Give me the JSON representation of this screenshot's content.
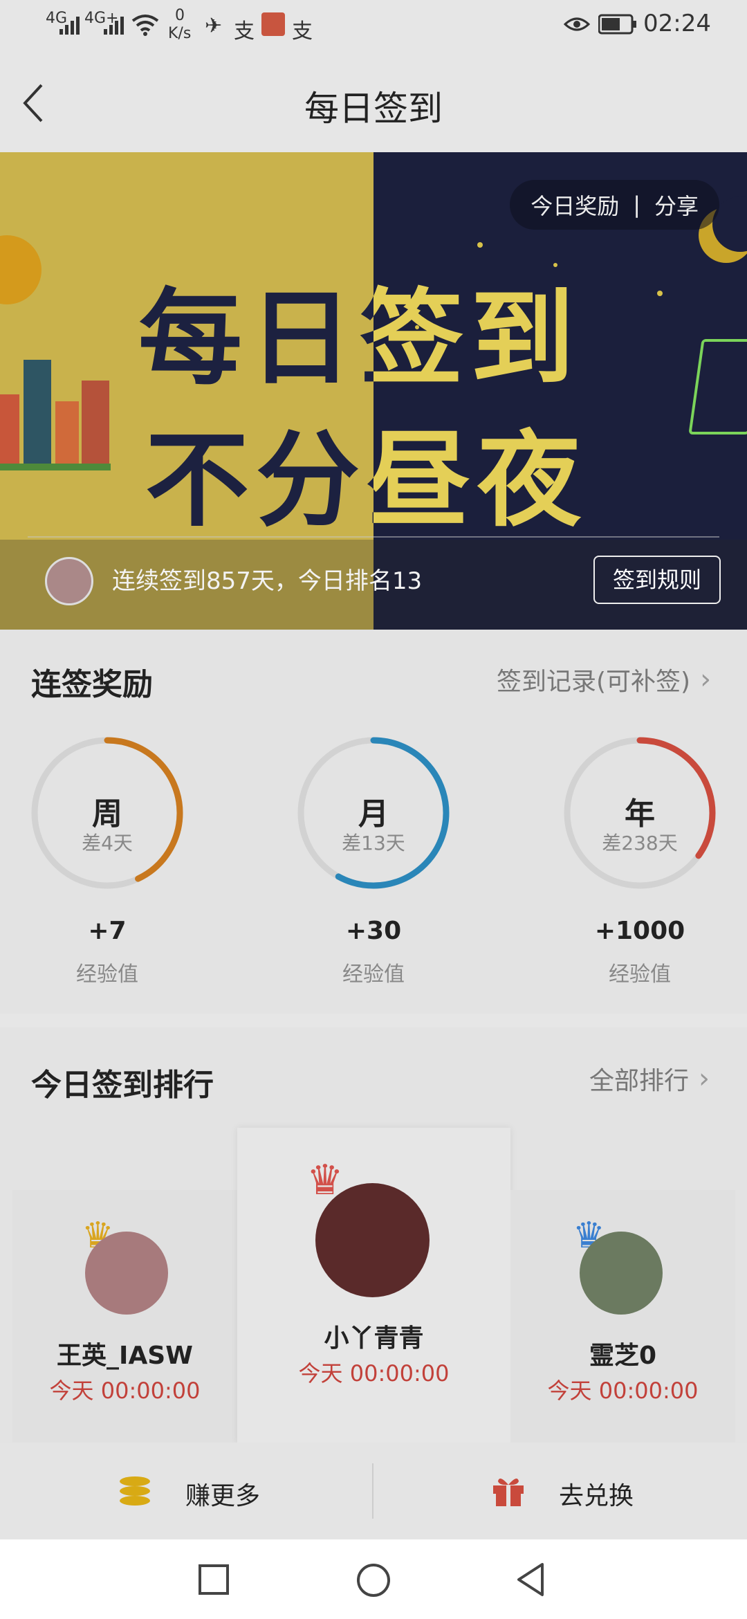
{
  "status_bar": {
    "network_1": "4G",
    "network_2": "4G+",
    "speed_value": "0",
    "speed_unit": "K/s",
    "time": "02:24"
  },
  "nav": {
    "title": "每日签到"
  },
  "banner": {
    "headline_line1": "每日签到",
    "headline_line2": "不分昼夜",
    "reward_label": "今日奖励",
    "separator": "|",
    "share_label": "分享",
    "streak_text": "连续签到857天，今日排名13",
    "rules_button": "签到规则"
  },
  "streak_rewards": {
    "title": "连签奖励",
    "record_link": "签到记录(可补签)",
    "items": [
      {
        "period": "周",
        "remaining": "差4天",
        "reward": "+7",
        "unit": "经验值",
        "progress": 0.43,
        "color": "#c8781e"
      },
      {
        "period": "月",
        "remaining": "差13天",
        "reward": "+30",
        "unit": "经验值",
        "progress": 0.58,
        "color": "#2a86b8"
      },
      {
        "period": "年",
        "remaining": "差238天",
        "reward": "+1000",
        "unit": "经验值",
        "progress": 0.35,
        "color": "#c94a3c"
      }
    ]
  },
  "ranking": {
    "title": "今日签到排行",
    "all_link": "全部排行",
    "entries": [
      {
        "name": "王英_IASW",
        "time": "今天 00:00:00",
        "crown_color": "#d9a520"
      },
      {
        "name": "小丫青青",
        "time": "今天 00:00:00",
        "crown_color": "#d2504a"
      },
      {
        "name": "霊芝0",
        "time": "今天 00:00:00",
        "crown_color": "#3a7fd0"
      }
    ]
  },
  "actions": {
    "earn_more": "赚更多",
    "redeem": "去兑换"
  }
}
